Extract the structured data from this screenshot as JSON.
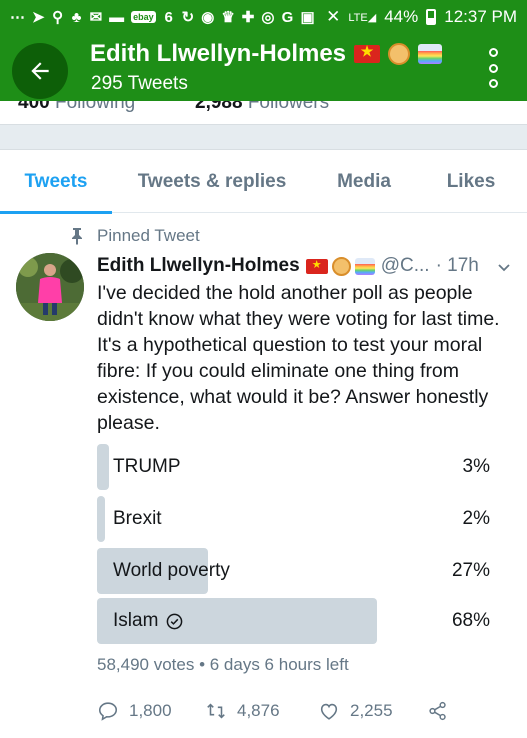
{
  "status_bar": {
    "battery": "44%",
    "time": "12:37 PM",
    "ebay_badge": "ebay",
    "signal_label": "LTE"
  },
  "header": {
    "name": "Edith Llwellyn-Holmes",
    "tweet_count": "295 Tweets",
    "bg_color": "#1e8e17"
  },
  "profile_counts": {
    "following_count": "400",
    "following_label": "Following",
    "followers_count": "2,988",
    "followers_label": "Followers"
  },
  "tabs": [
    {
      "label": "Tweets",
      "active": true
    },
    {
      "label": "Tweets & replies",
      "active": false
    },
    {
      "label": "Media",
      "active": false
    },
    {
      "label": "Likes",
      "active": false
    }
  ],
  "tweet": {
    "pinned_label": "Pinned Tweet",
    "author": "Edith Llwellyn-Holmes",
    "handle": "@C...",
    "time": "· 17h",
    "text": "I've decided the hold another poll as people didn't know what they were voting for last time. It's a hypothetical question to test your moral fibre: If you could eliminate one thing from existence, what would it be? Answer honestly please.",
    "poll": {
      "options": [
        {
          "label": "TRUMP",
          "percent": "3%",
          "value": 3,
          "selected": false
        },
        {
          "label": "Brexit",
          "percent": "2%",
          "value": 2,
          "selected": false
        },
        {
          "label": "World poverty",
          "percent": "27%",
          "value": 27,
          "selected": false
        },
        {
          "label": "Islam",
          "percent": "68%",
          "value": 68,
          "selected": true
        }
      ],
      "meta": "58,490 votes • 6 days 6 hours left"
    },
    "actions": {
      "replies": "1,800",
      "retweets": "4,876",
      "likes": "2,255"
    }
  },
  "icons": [
    "back-arrow-icon",
    "overflow-menu-icon",
    "pin-icon",
    "chevron-down-icon",
    "checkmark-circle-icon",
    "reply-icon",
    "retweet-icon",
    "like-icon",
    "share-icon"
  ]
}
